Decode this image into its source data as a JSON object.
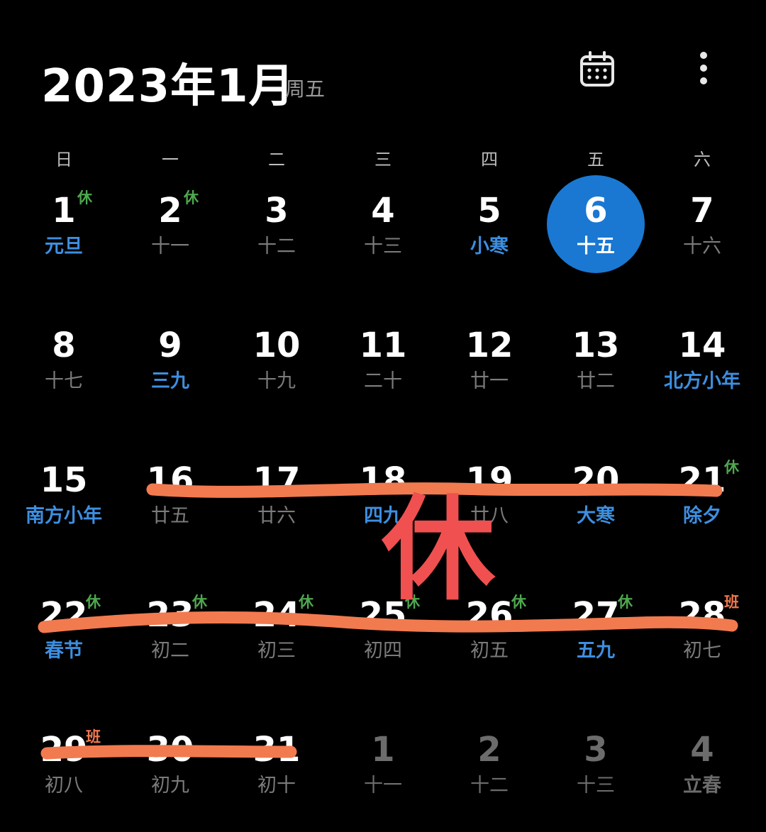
{
  "header": {
    "title": "2023年1月",
    "weekday": "周五"
  },
  "icons": {
    "calendar": "calendar-icon",
    "more": "more-vertical-icon"
  },
  "weekdays": [
    "日",
    "一",
    "二",
    "三",
    "四",
    "五",
    "六"
  ],
  "colors": {
    "background": "#000000",
    "today": "#1a78d2",
    "highlight": "#3d8fe0",
    "rest_badge": "#4ea84e",
    "work_badge": "#f07850",
    "annotation_stroke": "#f27a4f",
    "annotation_text": "#f05050"
  },
  "weeks": [
    [
      {
        "num": "1",
        "sub": "元旦",
        "hl": true,
        "badge": "休"
      },
      {
        "num": "2",
        "sub": "十一",
        "badge": "休"
      },
      {
        "num": "3",
        "sub": "十二"
      },
      {
        "num": "4",
        "sub": "十三"
      },
      {
        "num": "5",
        "sub": "小寒",
        "hl": true
      },
      {
        "num": "6",
        "sub": "十五",
        "today": true
      },
      {
        "num": "7",
        "sub": "十六"
      }
    ],
    [
      {
        "num": "8",
        "sub": "十七"
      },
      {
        "num": "9",
        "sub": "三九",
        "hl": true
      },
      {
        "num": "10",
        "sub": "十九"
      },
      {
        "num": "11",
        "sub": "二十"
      },
      {
        "num": "12",
        "sub": "廿一"
      },
      {
        "num": "13",
        "sub": "廿二"
      },
      {
        "num": "14",
        "sub": "北方小年",
        "hl": true
      }
    ],
    [
      {
        "num": "15",
        "sub": "南方小年",
        "hl": true
      },
      {
        "num": "16",
        "sub": "廿五"
      },
      {
        "num": "17",
        "sub": "廿六"
      },
      {
        "num": "18",
        "sub": "四九",
        "hl": true
      },
      {
        "num": "19",
        "sub": "廿八"
      },
      {
        "num": "20",
        "sub": "大寒",
        "hl": true
      },
      {
        "num": "21",
        "sub": "除夕",
        "hl": true,
        "badge": "休"
      }
    ],
    [
      {
        "num": "22",
        "sub": "春节",
        "hl": true,
        "badge": "休"
      },
      {
        "num": "23",
        "sub": "初二",
        "badge": "休"
      },
      {
        "num": "24",
        "sub": "初三",
        "badge": "休"
      },
      {
        "num": "25",
        "sub": "初四",
        "badge": "休"
      },
      {
        "num": "26",
        "sub": "初五",
        "badge": "休"
      },
      {
        "num": "27",
        "sub": "五九",
        "hl": true,
        "badge": "休"
      },
      {
        "num": "28",
        "sub": "初七",
        "badge": "班"
      }
    ],
    [
      {
        "num": "29",
        "sub": "初八",
        "badge": "班"
      },
      {
        "num": "30",
        "sub": "初九"
      },
      {
        "num": "31",
        "sub": "初十"
      },
      {
        "num": "1",
        "sub": "十一",
        "other": true
      },
      {
        "num": "2",
        "sub": "十二",
        "other": true
      },
      {
        "num": "3",
        "sub": "十三",
        "other": true
      },
      {
        "num": "4",
        "sub": "立春",
        "hl": true,
        "other": true
      }
    ]
  ],
  "annotation": {
    "text": "休"
  }
}
